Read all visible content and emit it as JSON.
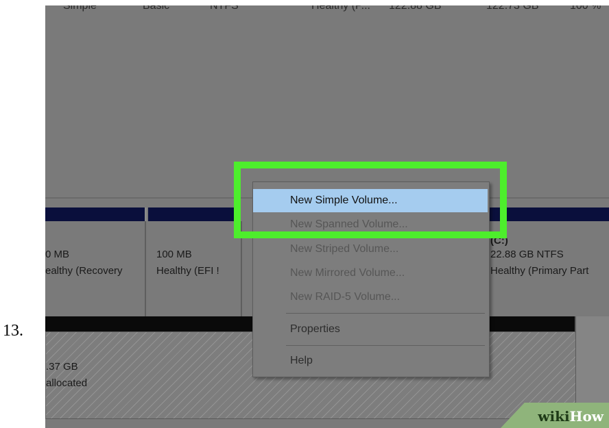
{
  "step_number": "13.",
  "volume_list_row": {
    "layout": "Simple",
    "type": "Basic",
    "file_system": "NTFS",
    "status": "Healthy (P...",
    "capacity": "122.88 GB",
    "free_space": "122.73 GB",
    "percent_free": "100 %"
  },
  "disk0_partitions": [
    {
      "size": "0 MB",
      "status": "ealthy (Recovery"
    },
    {
      "size": "100 MB",
      "status": "Healthy (EFI !"
    },
    {
      "size": "(C:)",
      "detail": "22.88 GB NTFS",
      "status": "Healthy (Primary Part"
    }
  ],
  "disk1_unallocated": {
    "size": ".37 GB",
    "status": "allocated"
  },
  "context_menu": {
    "items": [
      {
        "label": "New Simple Volume...",
        "state": "highlighted"
      },
      {
        "label": "New Spanned Volume...",
        "state": "disabled"
      },
      {
        "label": "New Striped Volume...",
        "state": "disabled"
      },
      {
        "label": "New Mirrored Volume...",
        "state": "disabled"
      },
      {
        "label": "New RAID-5 Volume...",
        "state": "disabled"
      },
      {
        "label": "Properties",
        "state": "enabled"
      },
      {
        "label": "Help",
        "state": "enabled"
      }
    ]
  },
  "highlight_color": "#4dee2c",
  "watermark": {
    "part1": "wiki",
    "part2": "How"
  }
}
